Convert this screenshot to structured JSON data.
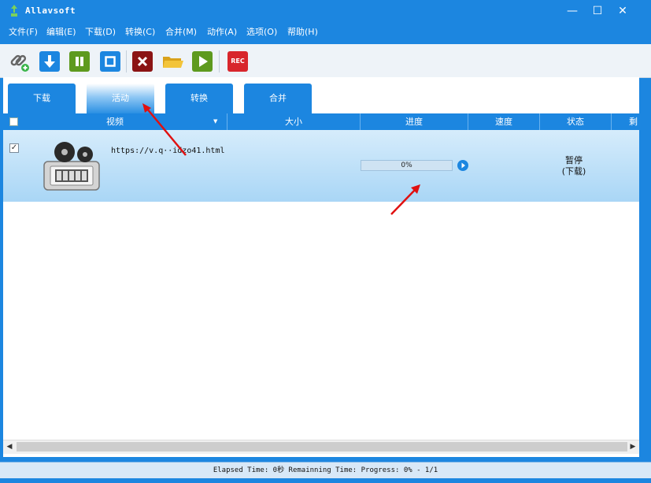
{
  "window": {
    "title": "Allavsoft",
    "minimize_label": "—",
    "maximize_label": "☐",
    "close_label": "✕"
  },
  "menu": [
    "文件(F)",
    "编辑(E)",
    "下载(D)",
    "转换(C)",
    "合并(M)",
    "动作(A)",
    "选项(O)",
    "帮助(H)"
  ],
  "toolbar": {
    "buttons": [
      "link-add-icon",
      "download-icon",
      "pause-icon",
      "stop-icon",
      "delete-icon",
      "folder-icon",
      "play-icon",
      "record-icon"
    ],
    "rec_label": "REC"
  },
  "tabs": [
    {
      "label": "下载",
      "active": false
    },
    {
      "label": "活动",
      "active": true
    },
    {
      "label": "转换",
      "active": false
    },
    {
      "label": "合并",
      "active": false
    }
  ],
  "columns": [
    "视频",
    "大小",
    "进度",
    "速度",
    "状态",
    "剩"
  ],
  "rows": [
    {
      "checked": true,
      "check_mark": "✓",
      "url": "https://v.q··idzo41.html",
      "progress_label": "0%",
      "progress": 0,
      "status_line1": "暂停",
      "status_line2": "(下载)"
    }
  ],
  "scrollbar": {
    "left_arrow": "◀",
    "right_arrow": "▶"
  },
  "statusbar": {
    "text": "Elapsed Time: 0秒 Remainning Time: Progress: 0% - 1/1"
  },
  "colors": {
    "accent": "#1c86e0",
    "row_selected": "#a9d6f6",
    "delete": "#8b1414",
    "record": "#d8262c"
  }
}
